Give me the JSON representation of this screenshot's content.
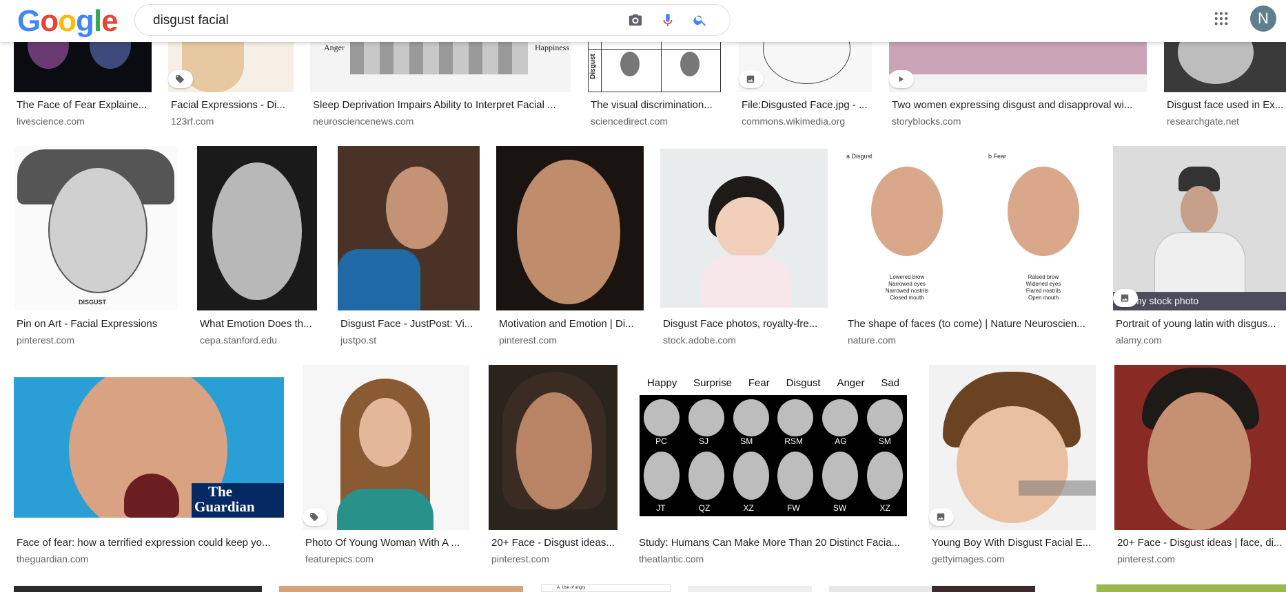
{
  "header": {
    "logo_letters": [
      "G",
      "o",
      "o",
      "g",
      "l",
      "e"
    ],
    "logo_colors": [
      "#4285F4",
      "#EA4335",
      "#FBBC05",
      "#4285F4",
      "#34A853",
      "#EA4335"
    ],
    "query": "disgust facial",
    "avatar_initial": "N"
  },
  "row1": [
    {
      "title": "The Face of Fear Explaine...",
      "source": "livescience.com"
    },
    {
      "title": "Facial Expressions - Di...",
      "source": "123rf.com"
    },
    {
      "title": "Sleep Deprivation Impairs Ability to Interpret Facial ...",
      "source": "neurosciencenews.com",
      "label_left": "Anger",
      "label_right": "Happiness"
    },
    {
      "title": "The visual discrimination...",
      "source": "sciencedirect.com",
      "label_side": "Disgust"
    },
    {
      "title": "File:Disgusted Face.jpg - ...",
      "source": "commons.wikimedia.org"
    },
    {
      "title": "Two women expressing disgust and disapproval wi...",
      "source": "storyblocks.com"
    },
    {
      "title": "Disgust face used in Ex...",
      "source": "researchgate.net"
    }
  ],
  "row2": [
    {
      "title": "Pin on Art - Facial Expressions",
      "source": "pinterest.com",
      "caption": "DISGUST"
    },
    {
      "title": "What Emotion Does th...",
      "source": "cepa.stanford.edu"
    },
    {
      "title": "Disgust Face - JustPost: Vi...",
      "source": "justpo.st"
    },
    {
      "title": "Motivation and Emotion | Di...",
      "source": "pinterest.com"
    },
    {
      "title": "Disgust Face photos, royalty-fre...",
      "source": "stock.adobe.com"
    },
    {
      "title": "The shape of faces (to come) | Nature Neuroscien...",
      "source": "nature.com",
      "panel_a": "a Disgust",
      "panel_b": "b Fear",
      "notes_a": [
        "Lowered brow",
        "Narrowed eyes",
        "Narrowed nostrils",
        "Closed mouth"
      ],
      "notes_b": [
        "Raised brow",
        "Widened eyes",
        "Flared nostrils",
        "Open mouth"
      ]
    },
    {
      "title": "Portrait of young latin with disgus...",
      "source": "alamy.com",
      "watermark": "my stock photo"
    }
  ],
  "row3": [
    {
      "title": "Face of fear: how a terrified expression could keep yo...",
      "source": "theguardian.com",
      "watermark": [
        "The",
        "Guardian"
      ]
    },
    {
      "title": "Photo Of Young Woman With A ...",
      "source": "featurepics.com"
    },
    {
      "title": "20+ Face - Disgust ideas...",
      "source": "pinterest.com"
    },
    {
      "title": "Study: Humans Can Make More Than 20 Distinct Facia...",
      "source": "theatlantic.com",
      "headers": [
        "Happy",
        "Surprise",
        "Fear",
        "Disgust",
        "Anger",
        "Sad"
      ],
      "labels_top": [
        "PC",
        "SJ",
        "SM",
        "RSM",
        "AG",
        "SM"
      ],
      "labels_bottom": [
        "JT",
        "QZ",
        "XZ",
        "FW",
        "SW",
        "XZ"
      ]
    },
    {
      "title": "Young Boy With Disgust Facial E...",
      "source": "gettyimages.com"
    },
    {
      "title": "20+ Face - Disgust ideas | face, di...",
      "source": "pinterest.com"
    }
  ],
  "row4_partial": {
    "text": "A. Use of angry"
  }
}
